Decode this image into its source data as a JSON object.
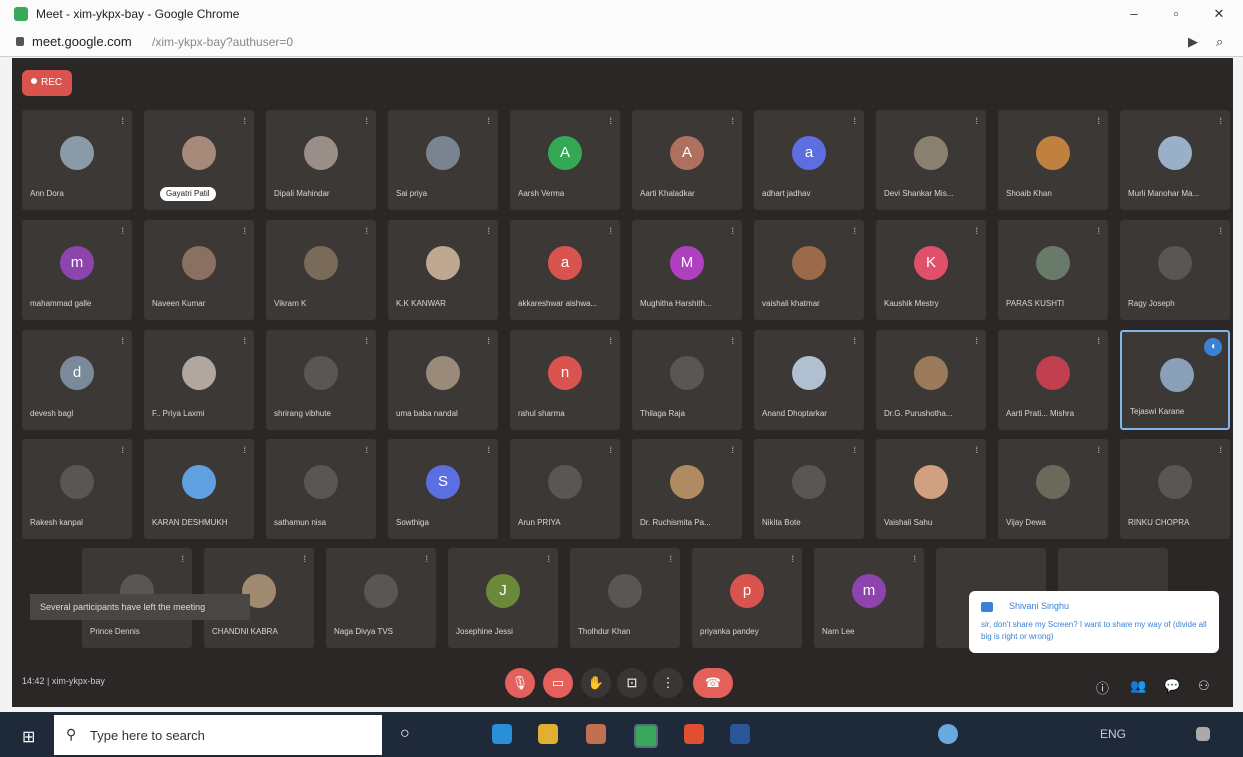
{
  "browser": {
    "title": "Meet - xim-ykpx-bay - Google Chrome",
    "url_host": "meet.google.com",
    "url_path": "/xim-ykpx-bay?authuser=0",
    "minimize": "–",
    "maximize": "▫",
    "close": "✕",
    "cast_icon": "▶",
    "zoom_icon": "⌕"
  },
  "meet": {
    "rec_label": "REC",
    "toast": "Several participants have left the meeting",
    "meeting_info": "14:42 | xim-ykpx-bay",
    "chat": {
      "from": "Shivani Singhu",
      "message": "sir, don't share my Screen? I want to share my way of (divide all big is right or wrong)"
    },
    "rows": [
      [
        {
          "name": "Ann Dora",
          "avatar": "photo",
          "color": "#8a9aa8"
        },
        {
          "name": "Gayatri Patil",
          "avatar": "photo",
          "color": "#a58a7a",
          "pill": true
        },
        {
          "name": "Dipali Mahindar",
          "avatar": "photo",
          "color": "#9a8f88"
        },
        {
          "name": "Sai priya",
          "avatar": "photo",
          "color": "#7a8490"
        },
        {
          "name": "Aarsh Verma",
          "avatar": "A",
          "color": "#34a853"
        },
        {
          "name": "Aarti Khaladkar",
          "avatar": "A",
          "color": "#b07060"
        },
        {
          "name": "adhart jadhav",
          "avatar": "a",
          "color": "#5b6fe0"
        },
        {
          "name": "Devi Shankar Mis...",
          "avatar": "photo",
          "color": "#8a8070"
        },
        {
          "name": "Shoaib Khan",
          "avatar": "photo",
          "color": "#c08040"
        },
        {
          "name": "Murli Manohar Ma...",
          "avatar": "photo",
          "color": "#9ab0c8"
        }
      ],
      [
        {
          "name": "mahammad galle",
          "avatar": "m",
          "color": "#8e44ad"
        },
        {
          "name": "Naveen Kumar",
          "avatar": "photo",
          "color": "#8a7060"
        },
        {
          "name": "Vikram K",
          "avatar": "photo",
          "color": "#7a6a5a"
        },
        {
          "name": "K.K KANWAR",
          "avatar": "photo",
          "color": "#c0a890"
        },
        {
          "name": "akkareshwar aishwa...",
          "avatar": "a",
          "color": "#d9534f"
        },
        {
          "name": "Mughitha Harshith...",
          "avatar": "M",
          "color": "#b040c0"
        },
        {
          "name": "vaishali khatmar",
          "avatar": "photo",
          "color": "#9a6a4a"
        },
        {
          "name": "Kaushik Mestry",
          "avatar": "K",
          "color": "#e0506a"
        },
        {
          "name": "PARAS KUSHTI",
          "avatar": "photo",
          "color": "#6a7a6a"
        },
        {
          "name": "Ragy Joseph",
          "avatar": "",
          "color": "#5a5654"
        }
      ],
      [
        {
          "name": "devesh bagl",
          "avatar": "d",
          "color": "#7a8a9a"
        },
        {
          "name": "F.. Priya Laxmi",
          "avatar": "photo",
          "color": "#b0a8a0"
        },
        {
          "name": "shrirang vibhute",
          "avatar": "",
          "color": "#5a5654"
        },
        {
          "name": "uma baba nandal",
          "avatar": "photo",
          "color": "#9a8a7a"
        },
        {
          "name": "rahul sharma",
          "avatar": "n",
          "color": "#d9534f"
        },
        {
          "name": "Thilaga Raja",
          "avatar": "",
          "color": "#5a5654"
        },
        {
          "name": "Anand Dhoptarkar",
          "avatar": "photo",
          "color": "#b0c0d0"
        },
        {
          "name": "Dr.G. Purushotha...",
          "avatar": "photo",
          "color": "#9a7a5a"
        },
        {
          "name": "Aarti Prati... Mishra",
          "avatar": "photo",
          "color": "#c04050"
        },
        {
          "name": "Tejaswi Karane",
          "avatar": "photo",
          "color": "#8aa0b8",
          "active": true
        }
      ],
      [
        {
          "name": "Rakesh kanpal",
          "avatar": "",
          "color": "#5a5654"
        },
        {
          "name": "KARAN DESHMUKH",
          "avatar": "photo",
          "color": "#60a0e0"
        },
        {
          "name": "sathamun nisa",
          "avatar": "",
          "color": "#5a5654"
        },
        {
          "name": "Sowthiga",
          "avatar": "S",
          "color": "#5b6fe0"
        },
        {
          "name": "Arun PRIYA",
          "avatar": "",
          "color": "#5a5654"
        },
        {
          "name": "Dr. Ruchismita Pa...",
          "avatar": "photo",
          "color": "#b08a60"
        },
        {
          "name": "Nikita Bote",
          "avatar": "",
          "color": "#5a5654"
        },
        {
          "name": "Vaishali Sahu",
          "avatar": "photo",
          "color": "#d0a080"
        },
        {
          "name": "Vijay Dewa",
          "avatar": "photo",
          "color": "#6a6a5a"
        },
        {
          "name": "RINKU CHOPRA",
          "avatar": "",
          "color": "#5a5654"
        }
      ],
      [
        {
          "name": "Prince Dennis",
          "avatar": "",
          "color": "#5a5654"
        },
        {
          "name": "CHANDNI KABRA",
          "avatar": "photo",
          "color": "#a08a70"
        },
        {
          "name": "Naga Divya TVS",
          "avatar": "",
          "color": "#5a5654"
        },
        {
          "name": "Josephine Jessi",
          "avatar": "J",
          "color": "#6a8a3a"
        },
        {
          "name": "Tholhdur Khan",
          "avatar": "",
          "color": "#5a5654"
        },
        {
          "name": "priyanka pandey",
          "avatar": "p",
          "color": "#d9534f"
        },
        {
          "name": "Nam Lee",
          "avatar": "m",
          "color": "#8e44ad"
        },
        {
          "name": "",
          "avatar": "",
          "color": "#3c3836"
        },
        {
          "name": "",
          "avatar": "",
          "color": "#3c3836"
        }
      ]
    ],
    "controls": {
      "mic_icon": "🎙",
      "cam_icon": "▭",
      "hand_icon": "✋",
      "present_icon": "⊡",
      "more_icon": "⋮",
      "end_icon": "☎"
    },
    "right_icons": {
      "info": "ⓘ",
      "people": "👥",
      "chat": "💬",
      "activities": "⚇"
    }
  },
  "taskbar": {
    "search_placeholder": "Type here to search",
    "start_icon": "⊞",
    "search_icon": "⚲",
    "cortana_icon": "○",
    "tray_text": "ENG"
  }
}
